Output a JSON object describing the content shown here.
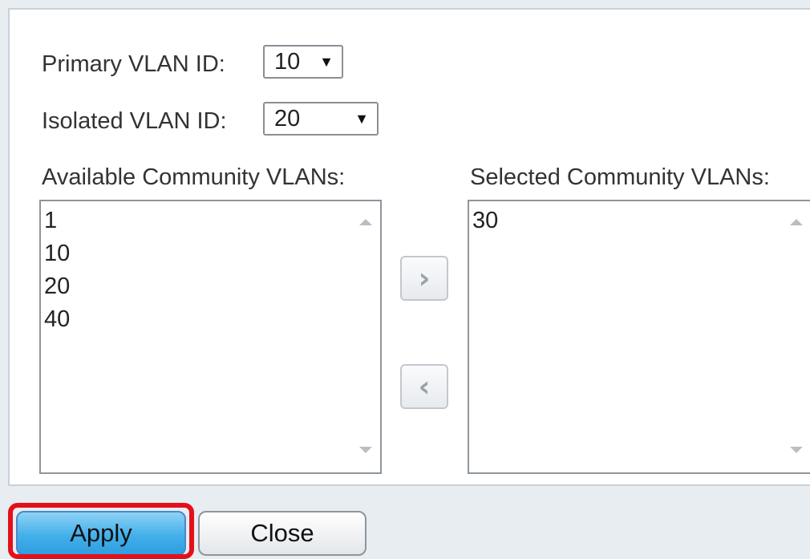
{
  "form": {
    "primary_vlan_label": "Primary VLAN ID:",
    "primary_vlan_value": "10",
    "isolated_vlan_label": "Isolated VLAN ID:",
    "isolated_vlan_value": "20",
    "available_label": "Available Community VLANs:",
    "selected_label": "Selected Community VLANs:",
    "available_items": [
      "1",
      "10",
      "20",
      "40"
    ],
    "selected_items": [
      "30"
    ],
    "move_right_glyph": "›",
    "move_left_glyph": "‹"
  },
  "buttons": {
    "apply": "Apply",
    "close": "Close"
  },
  "colors": {
    "apply_blue": "#43b0ea",
    "highlight_red": "#e3101a"
  }
}
